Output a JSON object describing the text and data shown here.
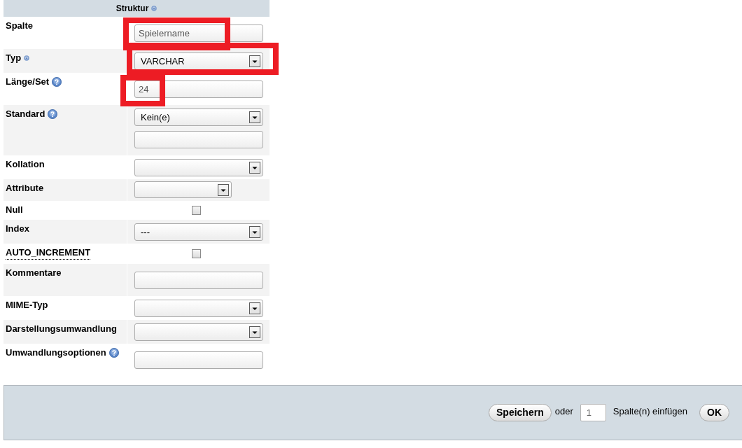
{
  "header": {
    "title": "Struktur",
    "help_icon": {
      "kind": "small"
    }
  },
  "fields": [
    {
      "label": "Spalte",
      "kind": "text",
      "value": "Spielername",
      "highlighted": true,
      "dotted_underline": false
    },
    {
      "label": "Typ",
      "help_icon": {
        "kind": "small"
      },
      "kind": "select",
      "value": "VARCHAR",
      "highlighted": true,
      "dotted_underline": false
    },
    {
      "label": "Länge/Set",
      "help_icon": {
        "kind": "large"
      },
      "kind": "text",
      "value": "24",
      "highlighted": true,
      "dotted_underline": false
    },
    {
      "label": "Standard",
      "help_icon": {
        "kind": "large"
      },
      "kind": "select_text",
      "value": "Kein(e)",
      "highlighted": false,
      "dotted_underline": false
    },
    {
      "label": "Kollation",
      "kind": "select",
      "highlighted": false,
      "dotted_underline": false
    },
    {
      "label": "Attribute",
      "kind": "select_short",
      "highlighted": false,
      "dotted_underline": false
    },
    {
      "label": "Null",
      "kind": "checkbox",
      "checked": false,
      "highlighted": false,
      "dotted_underline": false
    },
    {
      "label": "Index",
      "kind": "select",
      "value": "---",
      "highlighted": false,
      "dotted_underline": false
    },
    {
      "label": "AUTO_INCREMENT",
      "kind": "checkbox",
      "checked": false,
      "highlighted": false,
      "dotted_underline": true
    },
    {
      "label": "Kommentare",
      "kind": "text",
      "highlighted": false,
      "dotted_underline": false
    },
    {
      "label": "MIME-Typ",
      "kind": "select",
      "highlighted": false,
      "dotted_underline": false
    },
    {
      "label": "Darstellungsumwandlung",
      "kind": "select",
      "highlighted": false,
      "dotted_underline": false
    },
    {
      "label": "Umwandlungsoptionen",
      "help_icon": {
        "kind": "large"
      },
      "kind": "text",
      "highlighted": false,
      "dotted_underline": false
    }
  ],
  "footer": {
    "save_button": "Speichern",
    "or_label": "oder",
    "count_field": {
      "value": "1"
    },
    "insert_label": "Spalte(n) einfügen",
    "ok_button": "OK"
  }
}
